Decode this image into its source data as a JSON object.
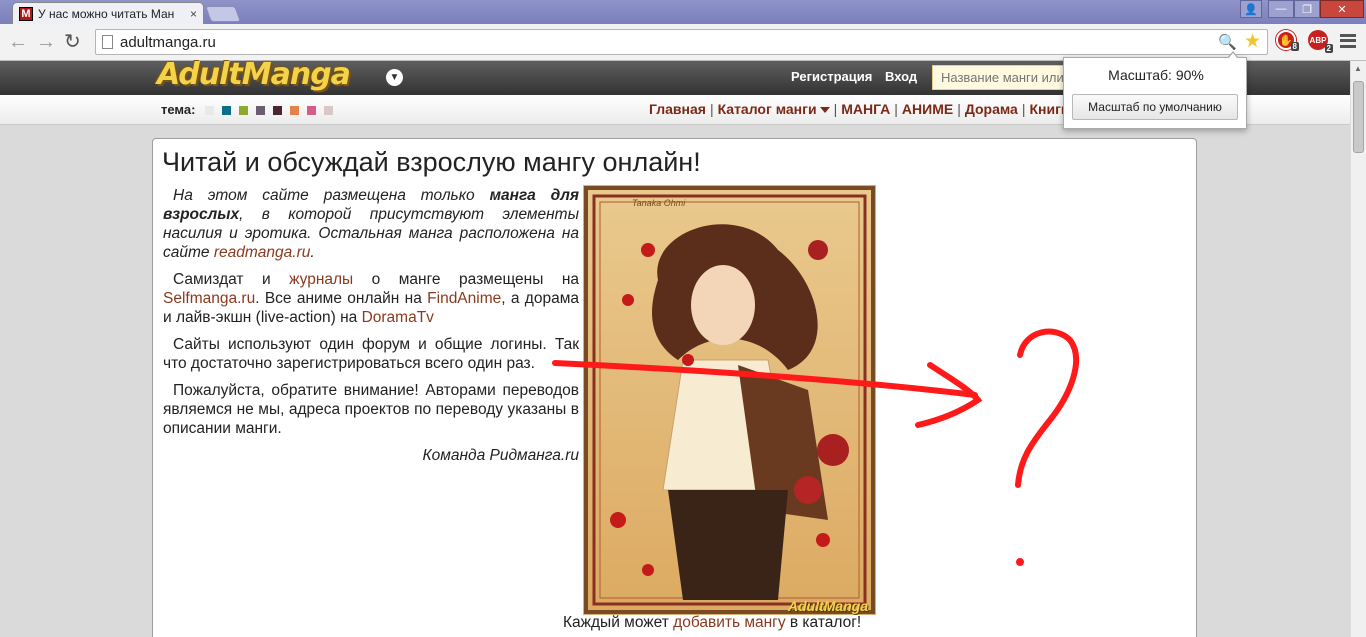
{
  "browser": {
    "tab_title": "У нас можно читать Ман",
    "tab_close": "×",
    "favicon_letter": "M",
    "url": "adultmanga.ru",
    "window_controls": {
      "user": "👤",
      "minimize": "—",
      "restore": "❐",
      "close": "✕"
    },
    "extensions": [
      {
        "name": "adblock",
        "badge": "8",
        "color": "#c81f1f"
      },
      {
        "name": "abp",
        "label": "ABP",
        "badge": "2",
        "color": "#c81f1f"
      }
    ],
    "zoom_popup": {
      "label": "Масштаб: 90%",
      "reset_label": "Масштаб по умолчанию"
    }
  },
  "site": {
    "logo": "AdultManga",
    "header": {
      "register": "Регистрация",
      "login": "Вход",
      "search_placeholder": "Название манги или"
    },
    "theme_label": "тема:",
    "theme_swatches": [
      "#e9e9e9",
      "#0b6f8c",
      "#8fa830",
      "#6a5d73",
      "#4a2630",
      "#e4814c",
      "#d65d8b",
      "#d8c8c8"
    ],
    "nav": [
      "Главная",
      "Каталог манги",
      "МАНГА",
      "АНИМЕ",
      "Дорама",
      "Книги"
    ],
    "page_title": "Читай и обсуждай взрослую мангу онлайн!",
    "intro": {
      "p1_a": "На этом сайте размещена только ",
      "p1_b": "манга для взрослых",
      "p1_c": ", в которой присутствуют элементы насилия и эротика. Остальная манга расположена на сайте ",
      "p1_link": "readmanga.ru",
      "p1_d": ".",
      "p2_a": "Самиздат и ",
      "p2_link1": "журналы",
      "p2_b": " о манге размещены на ",
      "p2_link2": "Selfmanga.ru",
      "p2_c": ". Все аниме онлайн на ",
      "p2_link3": "FindAnime",
      "p2_d": ", а дорама и лайв-экшн (live-action) на ",
      "p2_link4": "DoramaTv",
      "p3": "Сайты используют один форум и общие логины. Так что достаточно зарегистрироваться всего один раз.",
      "p4": "Пожалуйста, обратите внимание! Авторами переводов являемся не мы, адреса проектов по переводу указаны в описании манги.",
      "signature": "Команда Ридманга.ru"
    },
    "illustration": {
      "watermark": "AdultManga",
      "top_text": "Tanaka Ohmi"
    },
    "caption": {
      "a": "Каждый может ",
      "link": "добавить мангу",
      "b": " в каталог!"
    }
  },
  "annotation": {
    "color": "#ff1a1a",
    "mark": "arrow-and-question-mark"
  }
}
